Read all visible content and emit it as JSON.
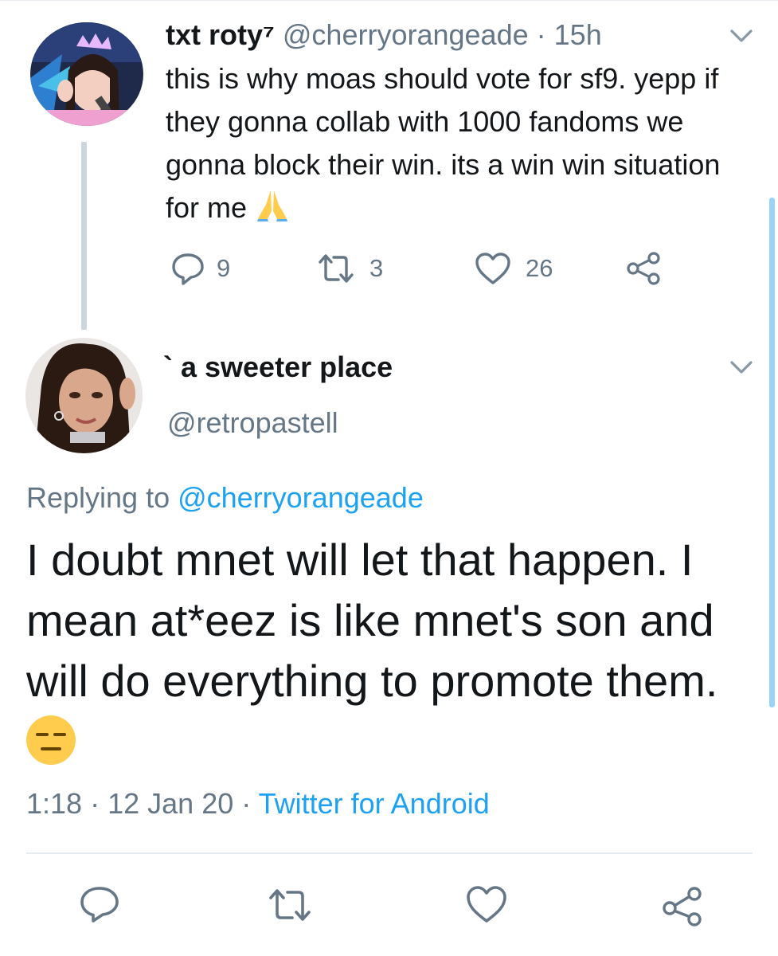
{
  "parent_tweet": {
    "display_name": "txt roty⁷",
    "handle": "@cherryorangeade",
    "time": "15h",
    "text": "this is why moas should vote for sf9. yepp if they gonna collab with 1000 fandoms we gonna block their win. its a win win situation for me",
    "emoji": "folded-hands-emoji",
    "actions": {
      "replies": "9",
      "retweets": "3",
      "likes": "26"
    }
  },
  "reply_tweet": {
    "display_name": "` a sweeter place",
    "handle": "@retropastell",
    "replying_prefix": "Replying to ",
    "replying_to": "@cherryorangeade",
    "text": "I doubt mnet will let that happen. I mean at*eez is like mnet's son and will do everything to promote them.",
    "emoji": "expressionless-face-emoji",
    "time": "1:18",
    "date": "12 Jan 20",
    "source": "Twitter for Android"
  },
  "colors": {
    "accent": "#1da1f2",
    "muted": "#657786",
    "divider": "#e6ecf0",
    "emoji_yellow": "#ffcc4d"
  },
  "icons": [
    "chevron-down-icon",
    "reply-icon",
    "retweet-icon",
    "like-icon",
    "share-icon"
  ]
}
